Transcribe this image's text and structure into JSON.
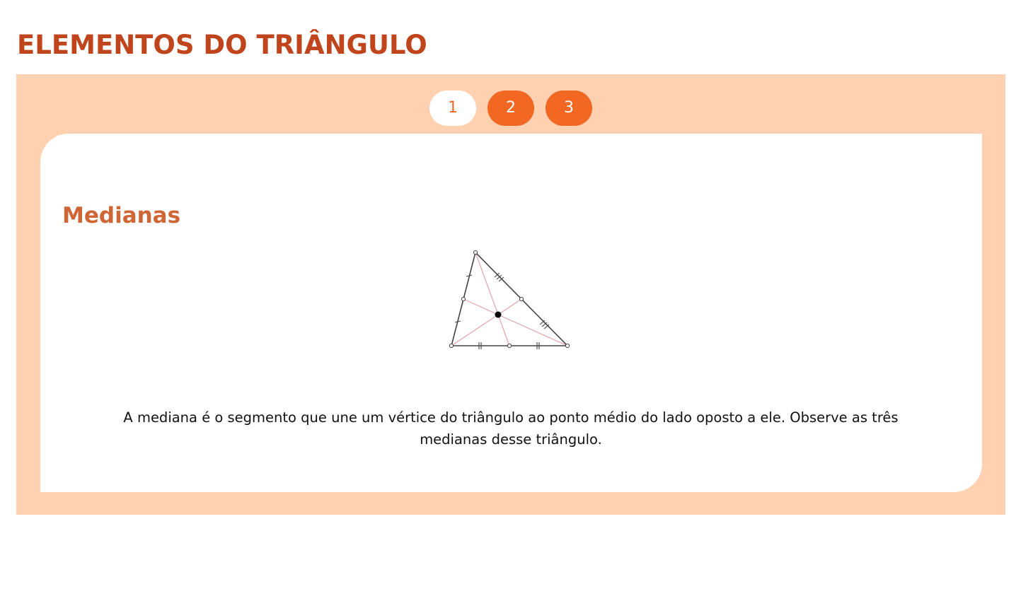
{
  "page": {
    "title": "ELEMENTOS DO TRIÂNGULO"
  },
  "pager": {
    "pages": [
      "1",
      "2",
      "3"
    ],
    "active": "1"
  },
  "content": {
    "heading": "Medianas",
    "figure_icon": "triangle-medians-diagram",
    "text": "A mediana é o segmento que une um vértice do triângulo ao ponto médio do lado oposto a ele. Observe as três medianas desse triângulo."
  },
  "colors": {
    "title": "#c0441c",
    "heading": "#cf6636",
    "panel_background": "#ffd1b0",
    "pager_active_bg": "#ffffff",
    "pager_inactive_bg": "#f26722",
    "median_lines": "#e3a3a8"
  }
}
